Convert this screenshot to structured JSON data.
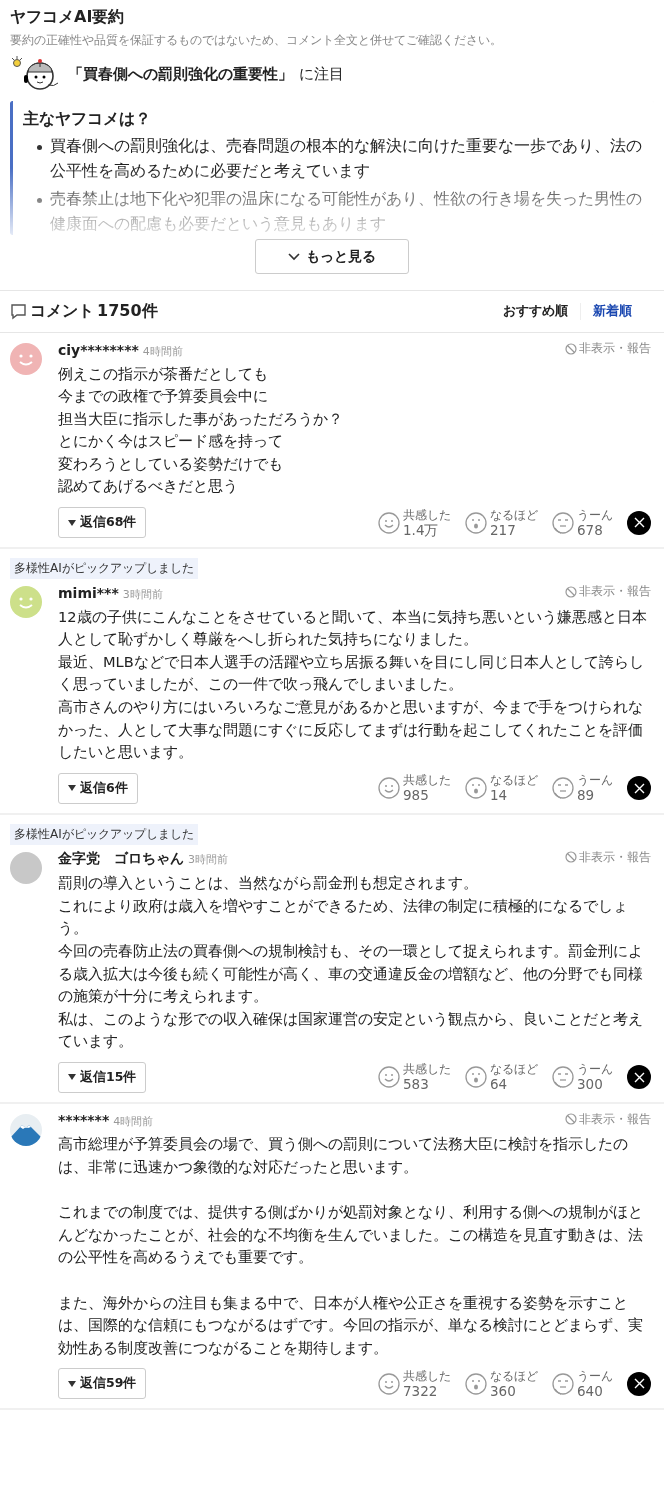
{
  "summary": {
    "title": "ヤフコメAI要約",
    "disclaimer": "要約の正確性や品質を保証するものではないため、コメント全文と併せてご確認ください。",
    "focus_topic": "「買春側への罰則強化の重要性」",
    "focus_suffix": "に注目",
    "box_title": "主なヤフコメは？",
    "expanded": false,
    "points": [
      "買春側への罰則強化は、売春問題の根本的な解決に向けた重要な一歩であり、法の公平性を高めるために必要だと考えています",
      "売春禁止は地下化や犯罪の温床になる可能性があり、性欲の行き場を失った男性の健康面への配慮も必要だという意見もあります"
    ],
    "more_button": "もっと見る"
  },
  "comments_header": {
    "title": "コメント",
    "count": "1750件",
    "sort_tabs": [
      {
        "label": "おすすめ順",
        "selected": false
      },
      {
        "label": "新着順",
        "selected": true
      }
    ]
  },
  "comments": [
    {
      "avatar": {
        "kind": "smiley",
        "color": "#f0b4b4"
      },
      "user": "ciy********",
      "time": "4時間前",
      "hide_report": "非表示・報告",
      "body": [
        [
          "例えこの指示が茶番だとしても",
          "今までの政権で予算委員会中に",
          "担当大臣に指示した事があっただろうか？",
          "とにかく今はスピード感を持って",
          "変わろうとしている姿勢だけでも",
          "認めてあげるべきだと思う"
        ]
      ],
      "replies": "返信68件",
      "reactions": [
        {
          "label": "共感した",
          "count": "1.4万"
        },
        {
          "label": "なるほど",
          "count": "217"
        },
        {
          "label": "うーん",
          "count": "678"
        }
      ]
    },
    {
      "pickup": "多様性AIがピックアップしました",
      "avatar": {
        "kind": "smiley",
        "color": "#cde08a"
      },
      "user": "mimi***",
      "time": "3時間前",
      "hide_report": "非表示・報告",
      "body": [
        [
          "12歳の子供にこんなことをさせていると聞いて、本当に気持ち悪いという嫌悪感と日本人として恥ずかしく尊厳をへし折られた気持ちになりました。",
          "最近、MLBなどで日本人選手の活躍や立ち居振る舞いを目にし同じ日本人として誇らしく思っていましたが、この一件で吹っ飛んでしまいました。",
          "高市さんのやり方にはいろいろなご意見があるかと思いますが、今まで手をつけられなかった、人として大事な問題にすぐに反応してまずは行動を起こしてくれたことを評価したいと思います。"
        ]
      ],
      "replies": "返信6件",
      "reactions": [
        {
          "label": "共感した",
          "count": "985"
        },
        {
          "label": "なるほど",
          "count": "14"
        },
        {
          "label": "うーん",
          "count": "89"
        }
      ]
    },
    {
      "pickup": "多様性AIがピックアップしました",
      "avatar": {
        "kind": "photo",
        "color": "#c8c8c8"
      },
      "user": "金字党　ゴロちゃん",
      "time": "3時間前",
      "hide_report": "非表示・報告",
      "body": [
        [
          "罰則の導入ということは、当然ながら罰金刑も想定されます。",
          "これにより政府は歳入を増やすことができるため、法律の制定に積極的になるでしょう。",
          "今回の売春防止法の買春側への規制検討も、その一環として捉えられます。罰金刑による歳入拡大は今後も続く可能性が高く、車の交通違反金の増額など、他の分野でも同様の施策が十分に考えられます。",
          "私は、このような形での収入確保は国家運営の安定という観点から、良いことだと考えています。"
        ]
      ],
      "replies": "返信15件",
      "reactions": [
        {
          "label": "共感した",
          "count": "583"
        },
        {
          "label": "なるほど",
          "count": "64"
        },
        {
          "label": "うーん",
          "count": "300"
        }
      ]
    },
    {
      "avatar": {
        "kind": "mountain",
        "color": "#2a78b8"
      },
      "user": "*******",
      "time": "4時間前",
      "hide_report": "非表示・報告",
      "body": [
        [
          "高市総理が予算委員会の場で、買う側への罰則について法務大臣に検討を指示したのは、非常に迅速かつ象徴的な対応だったと思います。"
        ],
        [
          "これまでの制度では、提供する側ばかりが処罰対象となり、利用する側への規制がほとんどなかったことが、社会的な不均衡を生んでいました。この構造を見直す動きは、法の公平性を高めるうえでも重要です。"
        ],
        [
          "また、海外からの注目も集まる中で、日本が人権や公正さを重視する姿勢を示すことは、国際的な信頼にもつながるはずです。今回の指示が、単なる検討にとどまらず、実効性ある制度改善につながることを期待します。"
        ]
      ],
      "replies": "返信59件",
      "reactions": [
        {
          "label": "共感した",
          "count": "7322"
        },
        {
          "label": "なるほど",
          "count": "360"
        },
        {
          "label": "うーん",
          "count": "640"
        }
      ]
    }
  ]
}
